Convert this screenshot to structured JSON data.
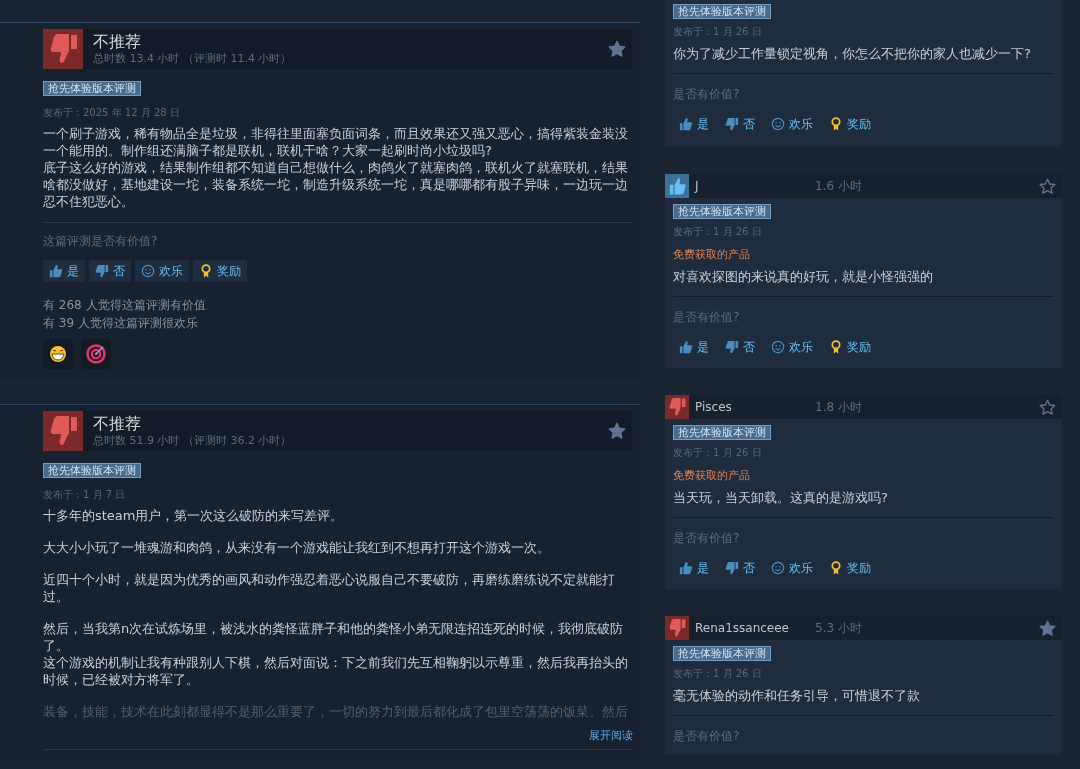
{
  "left_reviews": [
    {
      "recommended": false,
      "verdict": "不推荐",
      "hours": "总时数 13.4 小时 （评测时 11.4 小时）",
      "starred": true,
      "tag": "抢先体验版本评测",
      "date": "发布于：2025 年 12 月 28 日",
      "paragraphs": [
        {
          "lines": [
            "一个刷子游戏，稀有物品全是垃圾，非得往里面塞负面词条，而且效果还又强又恶心，搞得紫装金装没一个能用的。制作组还满脑子都是联机，联机干啥？大家一起刷时尚小垃圾吗?",
            "底子这么好的游戏，结果制作组都不知道自己想做什么，肉鸽火了就塞肉鸽，联机火了就塞联机，结果啥都没做好，基地建设一坨，装备系统一坨，制造升级系统一坨，真是哪哪都有股子异味，一边玩一边忍不住犯恶心。"
          ],
          "faded": false
        }
      ],
      "prompt": "这篇评测是否有价值?",
      "buttons": [
        {
          "kind": "yes",
          "label": "是"
        },
        {
          "kind": "no",
          "label": "否"
        },
        {
          "kind": "funny",
          "label": "欢乐"
        },
        {
          "kind": "award",
          "label": "奖励"
        }
      ],
      "counts": [
        "有 268 人觉得这篇评测有价值",
        "有 39 人觉得这篇评测很欢乐"
      ],
      "awards": [
        {
          "kind": "laugh"
        },
        {
          "kind": "target"
        }
      ]
    },
    {
      "recommended": false,
      "verdict": "不推荐",
      "hours": "总时数 51.9 小时 （评测时 36.2 小时）",
      "starred": true,
      "tag": "抢先体验版本评测",
      "date": "发布于：1 月 7 日",
      "paragraphs": [
        {
          "lines": [
            "十多年的steam用户，第一次这么破防的来写差评。"
          ],
          "faded": false
        },
        {
          "lines": [
            "大大小小玩了一堆魂游和肉鸽，从来没有一个游戏能让我红到不想再打开这个游戏一次。"
          ],
          "faded": false
        },
        {
          "lines": [
            "近四十个小时，就是因为优秀的画风和动作强忍着恶心说服自己不要破防，再磨练磨练说不定就能打过。"
          ],
          "faded": false
        },
        {
          "lines": [
            "然后，当我第n次在试炼场里，被浅水的粪怪蓝胖子和他的粪怪小弟无限连招连死的时候，我彻底破防了。",
            "这个游戏的机制让我有种跟别人下棋，然后对面说：下之前我们先互相鞠躬以示尊重，然后我再抬头的时候，已经被对方将军了。"
          ],
          "faded": false
        },
        {
          "lines": [
            "装备，技能，技术在此刻都显得不是那么重要了，一切的努力到最后都化成了包里空荡荡的饭菜。然后"
          ],
          "faded": true
        }
      ],
      "read_more": "展开阅读"
    }
  ],
  "right_reviews": [
    {
      "tag": "抢先体验版本评测",
      "date": "发布于：1 月 26 日",
      "text": "你为了减少工作量锁定视角，你怎么不把你的家人也减少一下?",
      "prompt": "是否有价值?",
      "buttons": [
        {
          "kind": "yes",
          "label": "是"
        },
        {
          "kind": "no",
          "label": "否"
        },
        {
          "kind": "funny",
          "label": "欢乐"
        },
        {
          "kind": "award",
          "label": "奖励"
        }
      ]
    },
    {
      "user": {
        "name": "J",
        "hours": "1.6 小时",
        "recommended": true,
        "starred": false
      },
      "tag": "抢先体验版本评测",
      "date": "发布于：1 月 26 日",
      "free_product": "免费获取的产品",
      "text": "对喜欢探图的来说真的好玩，就是小怪强强的",
      "prompt": "是否有价值?",
      "buttons": [
        {
          "kind": "yes",
          "label": "是"
        },
        {
          "kind": "no",
          "label": "否"
        },
        {
          "kind": "funny",
          "label": "欢乐"
        },
        {
          "kind": "award",
          "label": "奖励"
        }
      ]
    },
    {
      "user": {
        "name": "Pisces",
        "hours": "1.8 小时",
        "recommended": false,
        "starred": false
      },
      "tag": "抢先体验版本评测",
      "date": "发布于：1 月 26 日",
      "free_product": "免费获取的产品",
      "text": "当天玩，当天卸载。这真的是游戏吗?",
      "prompt": "是否有价值?",
      "buttons": [
        {
          "kind": "yes",
          "label": "是"
        },
        {
          "kind": "no",
          "label": "否"
        },
        {
          "kind": "funny",
          "label": "欢乐"
        },
        {
          "kind": "award",
          "label": "奖励"
        }
      ]
    },
    {
      "user": {
        "name": "Rena1ssanceee",
        "hours": "5.3 小时",
        "recommended": false,
        "starred": true
      },
      "tag": "抢先体验版本评测",
      "date": "发布于：1 月 26 日",
      "text": "毫无体验的动作和任务引导，可惜退不了款",
      "prompt": "是否有价值?"
    }
  ]
}
